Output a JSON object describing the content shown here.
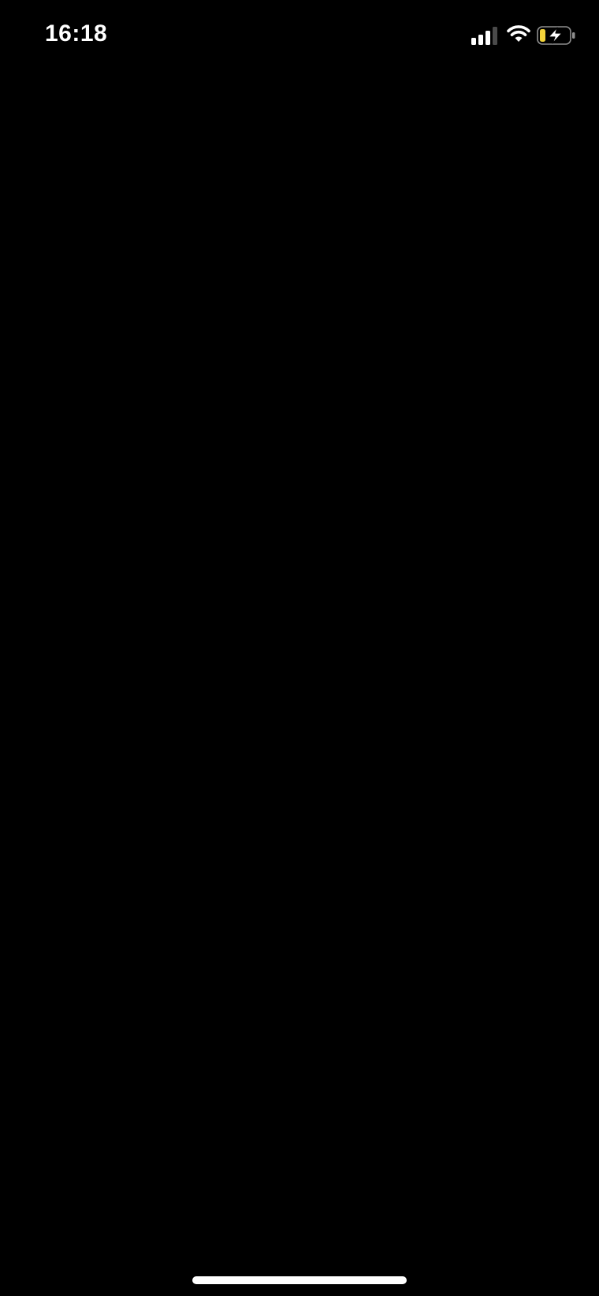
{
  "status_bar": {
    "time": "16:18",
    "icons": [
      "cellular-signal-icon",
      "wifi-icon",
      "battery-charging-icon"
    ],
    "signal_bars_filled": 3,
    "signal_bars_total": 4,
    "battery_level": 0.2
  },
  "colors": {
    "background": "#000000",
    "foreground": "#ffffff",
    "battery_low": "#f4d43a"
  }
}
